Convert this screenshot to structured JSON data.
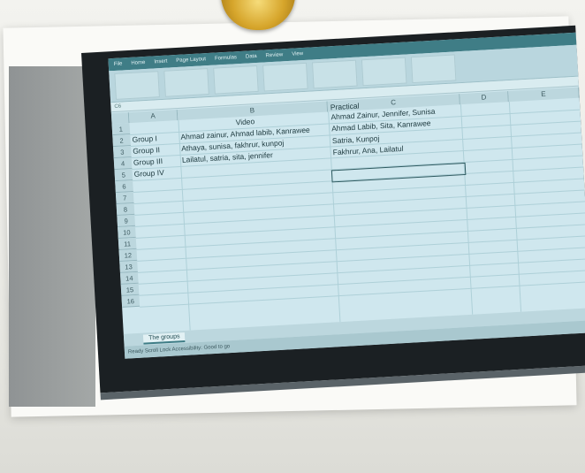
{
  "menu": [
    "File",
    "Home",
    "Insert",
    "Page Layout",
    "Formulas",
    "Data",
    "Review",
    "View"
  ],
  "formula_bar": {
    "name_box": "C6"
  },
  "columns": [
    "A",
    "B",
    "C",
    "D",
    "E"
  ],
  "rows": [
    "1",
    "2",
    "3",
    "4",
    "5",
    "6",
    "7",
    "8",
    "9",
    "10",
    "11",
    "12",
    "13",
    "14",
    "15",
    "16"
  ],
  "cells": {
    "b1": "Video",
    "c1": "Practical",
    "a2": "Group I",
    "b2": "Ahmad zainur, Ahmad labib, Kanrawee",
    "c1b": "Ahmad Zainur, Jennifer, Sunisa",
    "c2": "Ahmad Labib, Sita, Kanrawee",
    "a3": "Group II",
    "b3": "Athaya, sunisa, fakhrur, kunpoj",
    "c3": "Satria, Kunpoj",
    "a4": "Group III",
    "b4": "Lailatul, satria, sita, jennifer",
    "c4": "Fakhrur, Ana, Lailatul",
    "a5": "Group IV"
  },
  "sheet_tab": "The groups",
  "status": "Ready   Scroll Lock   Accessibility: Good to go"
}
